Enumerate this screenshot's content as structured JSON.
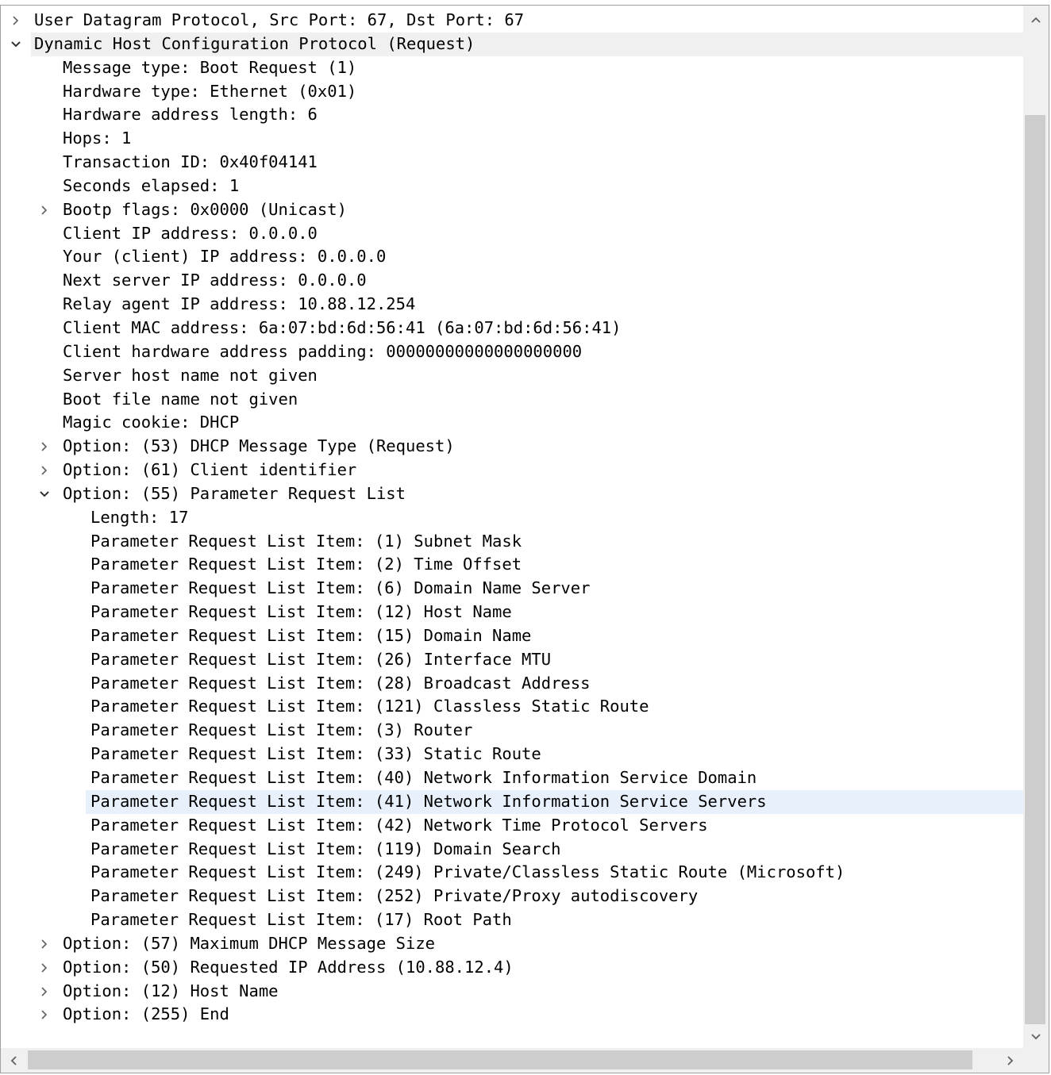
{
  "rows": [
    {
      "level": 0,
      "expander": "collapsed",
      "text": "User Datagram Protocol, Src Port: 67, Dst Port: 67"
    },
    {
      "level": 0,
      "expander": "expanded",
      "text": "Dynamic Host Configuration Protocol (Request)",
      "highlight": "top"
    },
    {
      "level": 1,
      "expander": "none",
      "text": "Message type: Boot Request (1)"
    },
    {
      "level": 1,
      "expander": "none",
      "text": "Hardware type: Ethernet (0x01)"
    },
    {
      "level": 1,
      "expander": "none",
      "text": "Hardware address length: 6"
    },
    {
      "level": 1,
      "expander": "none",
      "text": "Hops: 1"
    },
    {
      "level": 1,
      "expander": "none",
      "text": "Transaction ID: 0x40f04141"
    },
    {
      "level": 1,
      "expander": "none",
      "text": "Seconds elapsed: 1"
    },
    {
      "level": 1,
      "expander": "collapsed",
      "text": "Bootp flags: 0x0000 (Unicast)"
    },
    {
      "level": 1,
      "expander": "none",
      "text": "Client IP address: 0.0.0.0"
    },
    {
      "level": 1,
      "expander": "none",
      "text": "Your (client) IP address: 0.0.0.0"
    },
    {
      "level": 1,
      "expander": "none",
      "text": "Next server IP address: 0.0.0.0"
    },
    {
      "level": 1,
      "expander": "none",
      "text": "Relay agent IP address: 10.88.12.254"
    },
    {
      "level": 1,
      "expander": "none",
      "text": "Client MAC address: 6a:07:bd:6d:56:41 (6a:07:bd:6d:56:41)"
    },
    {
      "level": 1,
      "expander": "none",
      "text": "Client hardware address padding: 00000000000000000000"
    },
    {
      "level": 1,
      "expander": "none",
      "text": "Server host name not given"
    },
    {
      "level": 1,
      "expander": "none",
      "text": "Boot file name not given"
    },
    {
      "level": 1,
      "expander": "none",
      "text": "Magic cookie: DHCP"
    },
    {
      "level": 1,
      "expander": "collapsed",
      "text": "Option: (53) DHCP Message Type (Request)"
    },
    {
      "level": 1,
      "expander": "collapsed",
      "text": "Option: (61) Client identifier"
    },
    {
      "level": 1,
      "expander": "expanded",
      "text": "Option: (55) Parameter Request List"
    },
    {
      "level": 2,
      "expander": "none",
      "text": "Length: 17"
    },
    {
      "level": 2,
      "expander": "none",
      "text": "Parameter Request List Item: (1) Subnet Mask"
    },
    {
      "level": 2,
      "expander": "none",
      "text": "Parameter Request List Item: (2) Time Offset"
    },
    {
      "level": 2,
      "expander": "none",
      "text": "Parameter Request List Item: (6) Domain Name Server"
    },
    {
      "level": 2,
      "expander": "none",
      "text": "Parameter Request List Item: (12) Host Name"
    },
    {
      "level": 2,
      "expander": "none",
      "text": "Parameter Request List Item: (15) Domain Name"
    },
    {
      "level": 2,
      "expander": "none",
      "text": "Parameter Request List Item: (26) Interface MTU"
    },
    {
      "level": 2,
      "expander": "none",
      "text": "Parameter Request List Item: (28) Broadcast Address"
    },
    {
      "level": 2,
      "expander": "none",
      "text": "Parameter Request List Item: (121) Classless Static Route"
    },
    {
      "level": 2,
      "expander": "none",
      "text": "Parameter Request List Item: (3) Router"
    },
    {
      "level": 2,
      "expander": "none",
      "text": "Parameter Request List Item: (33) Static Route"
    },
    {
      "level": 2,
      "expander": "none",
      "text": "Parameter Request List Item: (40) Network Information Service Domain"
    },
    {
      "level": 2,
      "expander": "none",
      "text": "Parameter Request List Item: (41) Network Information Service Servers",
      "highlight": "selected"
    },
    {
      "level": 2,
      "expander": "none",
      "text": "Parameter Request List Item: (42) Network Time Protocol Servers"
    },
    {
      "level": 2,
      "expander": "none",
      "text": "Parameter Request List Item: (119) Domain Search"
    },
    {
      "level": 2,
      "expander": "none",
      "text": "Parameter Request List Item: (249) Private/Classless Static Route (Microsoft)"
    },
    {
      "level": 2,
      "expander": "none",
      "text": "Parameter Request List Item: (252) Private/Proxy autodiscovery"
    },
    {
      "level": 2,
      "expander": "none",
      "text": "Parameter Request List Item: (17) Root Path"
    },
    {
      "level": 1,
      "expander": "collapsed",
      "text": "Option: (57) Maximum DHCP Message Size"
    },
    {
      "level": 1,
      "expander": "collapsed",
      "text": "Option: (50) Requested IP Address (10.88.12.4)"
    },
    {
      "level": 1,
      "expander": "collapsed",
      "text": "Option: (12) Host Name"
    },
    {
      "level": 1,
      "expander": "collapsed",
      "text": "Option: (255) End"
    }
  ],
  "colors": {
    "selected_row": "#e8f1fb",
    "top_row": "#f0f0f0",
    "arrow": "#606060",
    "scroll_track": "#f0f0f0",
    "scroll_thumb": "#cdcdcd"
  },
  "icons": {
    "collapsed": "chevron-right-icon",
    "expanded": "chevron-down-icon",
    "scroll_up": "chevron-up-icon",
    "scroll_down": "chevron-down-icon",
    "scroll_left": "chevron-left-icon",
    "scroll_right": "chevron-right-icon"
  }
}
